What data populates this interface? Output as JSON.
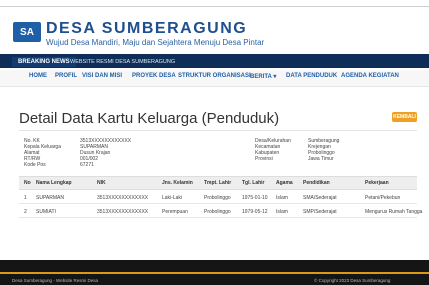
{
  "header": {
    "logo_text": "SA",
    "site_title": "DESA SUMBERAGUNG",
    "site_subtitle": "Wujud Desa Mandiri, Maju dan Sejahtera Menuju Desa Pintar"
  },
  "newsbar": {
    "label": "BREAKING NEWS",
    "text": "WEBSITE RESMI DESA SUMBERAGUNG"
  },
  "nav": {
    "items": [
      "HOME",
      "PROFIL",
      "VISI DAN MISI",
      "PROYEK DESA",
      "STRUKTUR ORGANISASI",
      "BERITA ▾",
      "DATA PENDUDUK",
      "AGENDA KEGIATAN"
    ]
  },
  "page": {
    "title": "Detail Data Kartu Keluarga (Penduduk)",
    "back_label": "KEMBALI"
  },
  "family_info": {
    "left": [
      {
        "label": "No. KK",
        "value": "3513XXXXXXXXXXXX"
      },
      {
        "label": "Kepala Keluarga",
        "value": "SUPARMAN"
      },
      {
        "label": "Alamat",
        "value": "Dusun Krajan"
      },
      {
        "label": "RT/RW",
        "value": "001/002"
      },
      {
        "label": "Kode Pos",
        "value": "67271"
      }
    ],
    "right": [
      {
        "label": "Desa/Kelurahan",
        "value": "Sumberagung"
      },
      {
        "label": "Kecamatan",
        "value": "Krejengan"
      },
      {
        "label": "Kabupaten",
        "value": "Probolinggo"
      },
      {
        "label": "Provinsi",
        "value": "Jawa Timur"
      }
    ]
  },
  "table": {
    "headers": [
      "No",
      "Nama Lengkap",
      "NIK",
      "Jns. Kelamin",
      "Tmpt. Lahir",
      "Tgl. Lahir",
      "Agama",
      "Pendidikan",
      "Pekerjaan"
    ],
    "rows": [
      [
        "1",
        "SUPARMAN",
        "3513XXXXXXXXXXXX",
        "Laki-Laki",
        "Probolinggo",
        "1975-01-10",
        "Islam",
        "SMA/Sederajat",
        "Petani/Pekebun"
      ],
      [
        "2",
        "SUMIATI",
        "3513XXXXXXXXXXXX",
        "Perempuan",
        "Probolinggo",
        "1979-05-12",
        "Islam",
        "SMP/Sederajat",
        "Mengurus Rumah Tangga"
      ]
    ]
  },
  "footer": {
    "left": "Desa Sumberagung - Website Resmi Desa",
    "right": "© Copyright 2023 Desa Sumberagung"
  }
}
